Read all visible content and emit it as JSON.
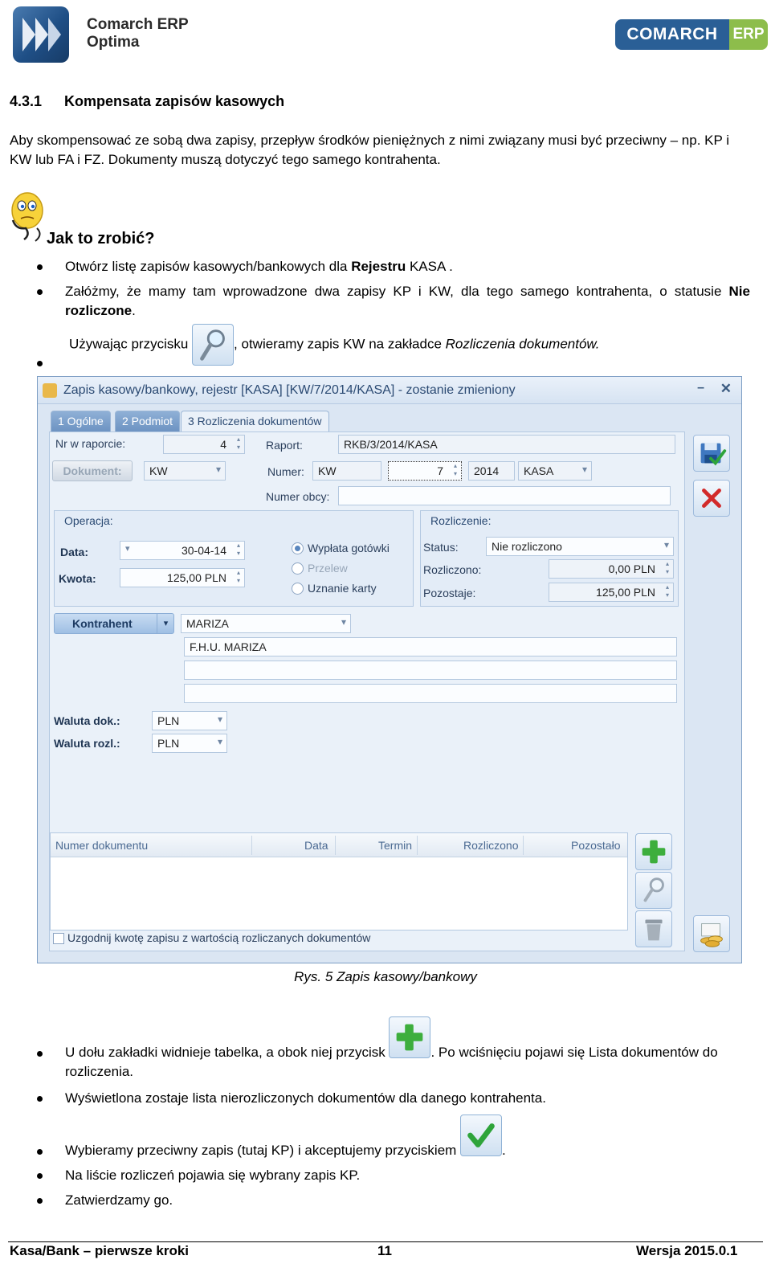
{
  "header": {
    "product_line1": "Comarch ERP",
    "product_line2": "Optima",
    "brand_main": "COMARCH",
    "brand_tag": "ERP"
  },
  "section": {
    "number": "4.3.1",
    "title": "Kompensata zapisów kasowych",
    "intro": "Aby skompensować ze sobą dwa zapisy, przepływ środków pieniężnych z nimi związany musi być przeciwny – np. KP i KW lub FA i FZ. Dokumenty muszą dotyczyć tego samego kontrahenta."
  },
  "howto": {
    "title": "Jak to zrobić?"
  },
  "steps": {
    "s1_pre": "Otwórz listę zapisów kasowych/bankowych dla ",
    "s1_bold": "Rejestru",
    "s1_post": " KASA .",
    "s2_pre": "Załóżmy, że mamy tam wprowadzone dwa zapisy KP i KW, dla tego samego kontrahenta, o statusie ",
    "s2_bold": "Nie rozliczone",
    "s2_post": ".",
    "s3_pre": "Używając przycisku ",
    "s3_mid": ", otwieramy zapis KW na zakładce ",
    "s3_italic": "Rozliczenia dokumentów.",
    "s4_pre": "U dołu zakładki widnieje tabelka, a obok niej przycisk ",
    "s4_post": ". Po wciśnięciu pojawi się Lista dokumentów do rozliczenia.",
    "s5": "Wyświetlona zostaje lista nierozliczonych dokumentów dla danego kontrahenta.",
    "s6_pre": "Wybieramy przeciwny zapis (tutaj KP) i akceptujemy przyciskiem ",
    "s6_post": ".",
    "s7": "Na liście rozliczeń pojawia się wybrany zapis KP.",
    "s8": "Zatwierdzamy go."
  },
  "window": {
    "title": "Zapis kasowy/bankowy, rejestr [KASA] [KW/7/2014/KASA] - zostanie zmieniony",
    "minimize": "–",
    "close": "✕",
    "tabs": [
      "1 Ogólne",
      "2 Podmiot",
      "3 Rozliczenia dokumentów"
    ],
    "nr_w_raporcie_label": "Nr w raporcie:",
    "nr_w_raporcie": "4",
    "raport_label": "Raport:",
    "raport": "RKB/3/2014/KASA",
    "dokument_btn": "Dokument:",
    "dokument": "KW",
    "numer_label": "Numer:",
    "numer_prefix": "KW",
    "numer_no": "7",
    "numer_year": "2014",
    "numer_reg": "KASA",
    "numer_obcy_label": "Numer obcy:",
    "numer_obcy": "",
    "operacja_title": "Operacja:",
    "data_label": "Data:",
    "data": "30-04-14",
    "kwota_label": "Kwota:",
    "kwota": "125,00 PLN",
    "radio_options": [
      "Wypłata gotówki",
      "Przelew",
      "Uznanie karty"
    ],
    "radio_selected": "Wypłata gotówki",
    "rozliczenie_title": "Rozliczenie:",
    "status_label": "Status:",
    "status": "Nie rozliczono",
    "rozliczono_label": "Rozliczono:",
    "rozliczono": "0,00 PLN",
    "pozostaje_label": "Pozostaje:",
    "pozostaje": "125,00 PLN",
    "kontrahent_btn": "Kontrahent",
    "kontrahent": "MARIZA",
    "kontrahent_name": "F.H.U. MARIZA",
    "address_line1": "",
    "address_line2": "",
    "waluta_dok_label": "Waluta dok.:",
    "waluta_dok": "PLN",
    "waluta_rozl_label": "Waluta rozl.:",
    "waluta_rozl": "PLN",
    "grid_columns": [
      "Numer dokumentu",
      "Data",
      "Termin",
      "Rozliczono",
      "Pozostało"
    ],
    "grid_rows": [],
    "checkbox_label": "Uzgodnij kwotę zapisu z wartością rozliczanych dokumentów"
  },
  "caption": "Rys. 5 Zapis kasowy/bankowy",
  "footer": {
    "left": "Kasa/Bank – pierwsze kroki",
    "page": "11",
    "right": "Wersja 2015.0.1"
  },
  "colors": {
    "brand_blue": "#2a5f96",
    "brand_green": "#8dbd4b",
    "window_bg": "#dbe6f3",
    "add_green": "#3dae3d",
    "delete_red": "#d22a2a"
  },
  "icons": [
    "optima-logo-icon",
    "thinker-icon",
    "magnifier-icon",
    "plus-icon",
    "checkmark-icon",
    "save-icon",
    "delete-icon",
    "trash-icon",
    "coins-icon"
  ]
}
